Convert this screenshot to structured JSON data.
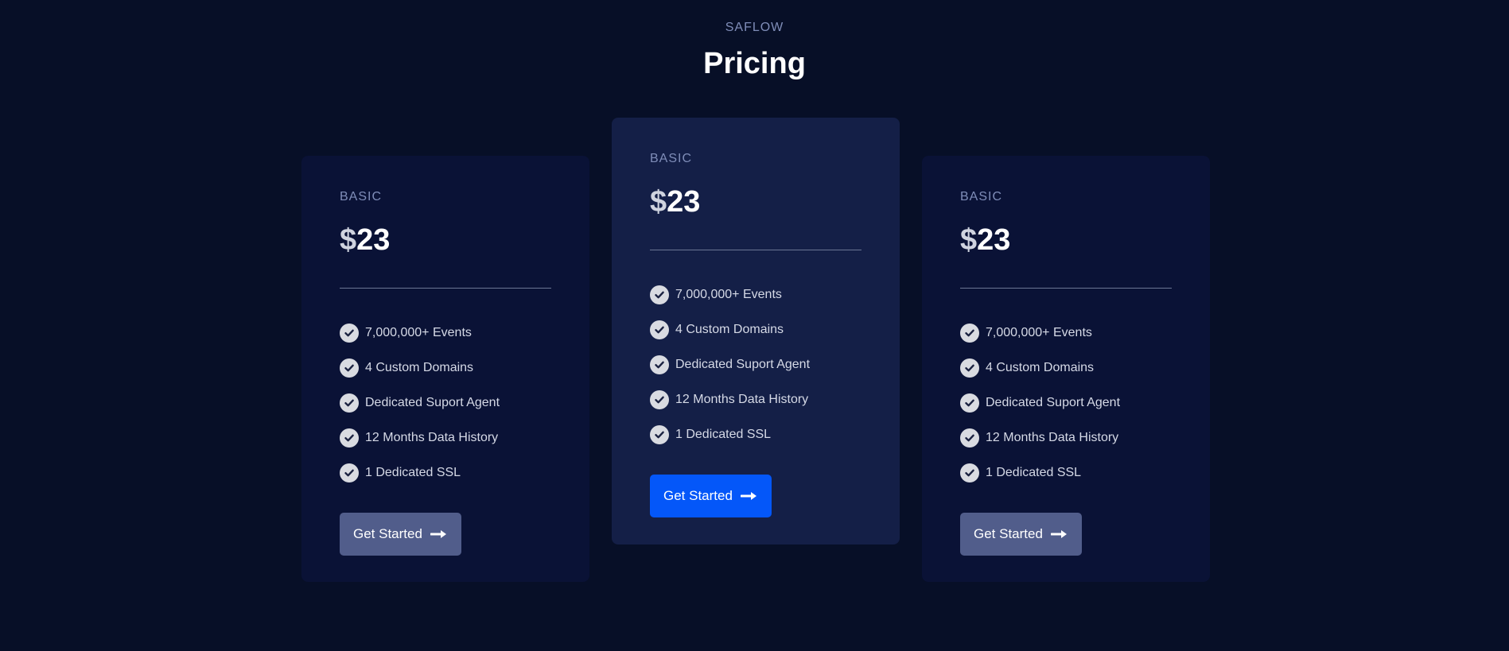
{
  "header": {
    "brand": "SAFLOW",
    "title": "Pricing"
  },
  "colors": {
    "background": "#070f27",
    "card": "#0a1236",
    "card_featured": "#141f47",
    "button": "#515d8b",
    "button_featured": "#0457f9",
    "muted_text": "#7f8db8"
  },
  "plans": [
    {
      "name": "BASIC",
      "currency": "$",
      "amount": "23",
      "features": [
        "7,000,000+ Events",
        "4 Custom Domains",
        "Dedicated Suport Agent",
        "12 Months Data History",
        "1 Dedicated SSL"
      ],
      "cta": "Get Started",
      "icon": "check-circle-icon"
    },
    {
      "name": "BASIC",
      "currency": "$",
      "amount": "23",
      "features": [
        "7,000,000+ Events",
        "4 Custom Domains",
        "Dedicated Suport Agent",
        "12 Months Data History",
        "1 Dedicated SSL"
      ],
      "cta": "Get Started",
      "icon": "check-circle-icon"
    },
    {
      "name": "BASIC",
      "currency": "$",
      "amount": "23",
      "features": [
        "7,000,000+ Events",
        "4 Custom Domains",
        "Dedicated Suport Agent",
        "12 Months Data History",
        "1 Dedicated SSL"
      ],
      "cta": "Get Started",
      "icon": "check-circle-icon"
    }
  ]
}
